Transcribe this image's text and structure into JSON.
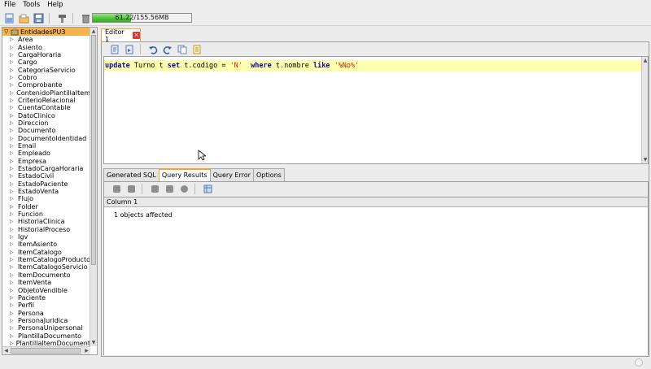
{
  "menu": {
    "file": "File",
    "tools": "Tools",
    "help": "Help"
  },
  "toolbar": {
    "memory_text": "61.22/155.56MB",
    "memory_used_fraction": 0.39
  },
  "tree": {
    "root_label": "EntidadesPU3",
    "items": [
      "Area",
      "Asiento",
      "CargaHoraria",
      "Cargo",
      "CategoriaServicio",
      "Cobro",
      "Comprobante",
      "ContenidoPlantillaItem",
      "CriterioRelacional",
      "CuentaContable",
      "DatoClinico",
      "Direccion",
      "Documento",
      "DocumentoIdentidad",
      "Email",
      "Empleado",
      "Empresa",
      "EstadoCargaHoraria",
      "EstadoCivil",
      "EstadoPaciente",
      "EstadoVenta",
      "Flujo",
      "Folder",
      "Funcion",
      "HistoriaClinica",
      "HistorialProceso",
      "Igv",
      "ItemAsiento",
      "ItemCatalogo",
      "ItemCatalogoProducto",
      "ItemCatalogoServicio",
      "ItemDocumento",
      "ItemVenta",
      "ObjetoVendible",
      "Paciente",
      "Perfil",
      "Persona",
      "PersonaJuridica",
      "PersonaUnipersonal",
      "PlantillaDocumento",
      "PlantillaItemDocumento"
    ]
  },
  "editor": {
    "tab_label": "Editor 1",
    "sql": {
      "k1": "update",
      "t1": " Turno t ",
      "k2": "set",
      "t2": " t.codigo = ",
      "s1": "'N'",
      "t3": "  ",
      "k3": "where",
      "t4": " t.nombre ",
      "k4": "like",
      "t5": " ",
      "s2": "'%No%'"
    }
  },
  "results": {
    "tabs": [
      "Generated SQL",
      "Query Results",
      "Query Error",
      "Options"
    ],
    "active_tab": "Query Results",
    "column_header": "Column 1",
    "message": "1 objects affected"
  }
}
